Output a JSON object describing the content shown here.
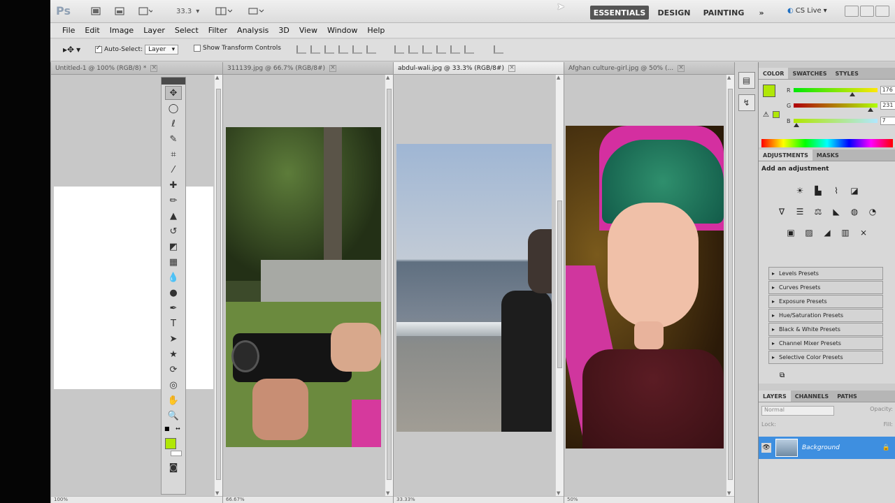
{
  "appbar": {
    "logo": "Ps",
    "zoom": "33.3",
    "workspaces": [
      "ESSENTIALS",
      "DESIGN",
      "PAINTING"
    ],
    "more": "»",
    "cslive": "CS Live"
  },
  "menu": [
    "File",
    "Edit",
    "Image",
    "Layer",
    "Select",
    "Filter",
    "Analysis",
    "3D",
    "View",
    "Window",
    "Help"
  ],
  "options": {
    "auto_select_label": "Auto-Select:",
    "auto_select_value": "Layer",
    "show_transform_label": "Show Transform Controls"
  },
  "documents": [
    {
      "title": "Untitled-1 @ 100% (RGB/8) *",
      "status": "100%"
    },
    {
      "title": "311139.jpg @ 66.7% (RGB/8#)",
      "status": "66.67%"
    },
    {
      "title": "abdul-wali.jpg @ 33.3% (RGB/8#)",
      "status": "33.33%"
    },
    {
      "title": "Afghan culture-girl.jpg @ 50% (...",
      "status": "50%"
    }
  ],
  "color_panel": {
    "tabs": [
      "COLOR",
      "SWATCHES",
      "STYLES"
    ],
    "channels": [
      {
        "label": "R",
        "value": "176"
      },
      {
        "label": "G",
        "value": "231"
      },
      {
        "label": "B",
        "value": "7"
      }
    ],
    "fg_color": "#b0e707"
  },
  "adjustments": {
    "tabs": [
      "ADJUSTMENTS",
      "MASKS"
    ],
    "title": "Add an adjustment",
    "presets": [
      "Levels Presets",
      "Curves Presets",
      "Exposure Presets",
      "Hue/Saturation Presets",
      "Black & White Presets",
      "Channel Mixer Presets",
      "Selective Color Presets"
    ]
  },
  "layers": {
    "tabs": [
      "LAYERS",
      "CHANNELS",
      "PATHS"
    ],
    "blend_mode": "Normal",
    "opacity_label": "Opacity:",
    "lock_label": "Lock:",
    "fill_label": "Fill:",
    "layer_name": "Background"
  }
}
